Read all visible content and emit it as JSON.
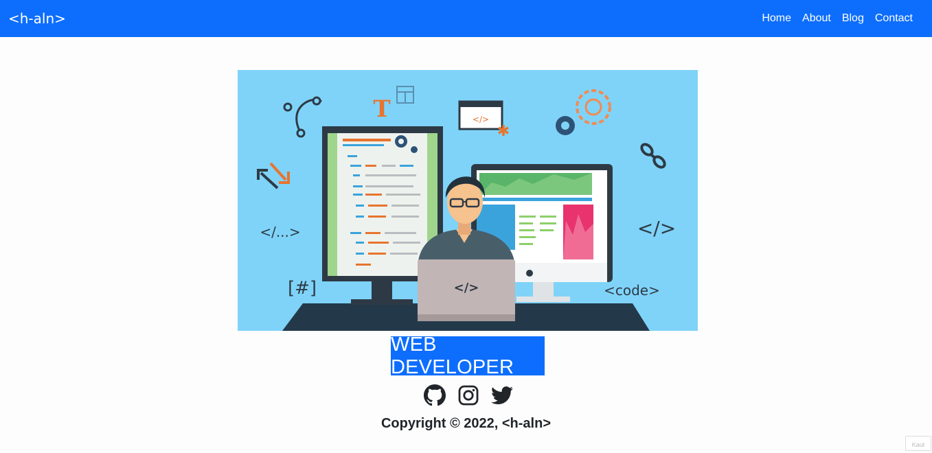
{
  "navbar": {
    "brand": "<h-aln>",
    "links": [
      {
        "label": "Home"
      },
      {
        "label": "About"
      },
      {
        "label": "Blog"
      },
      {
        "label": "Contact"
      }
    ],
    "background": "#0d6efd"
  },
  "hero": {
    "background": "#7fd3f8",
    "text_marks": {
      "tag_slash": "</...>",
      "tag_code_right": "</>",
      "hash": "[#]",
      "code_tag": "<code>",
      "laptop_code": "</>",
      "browser_code": "</>",
      "t_glyph": "T"
    }
  },
  "main": {
    "title": "WEB DEVELOPER",
    "title_background": "#0d6efd"
  },
  "social": [
    {
      "icon": "github-icon"
    },
    {
      "icon": "instagram-icon"
    },
    {
      "icon": "twitter-icon"
    }
  ],
  "footer": {
    "copyright": "Copyright © 2022, <h-aln>"
  },
  "widget": {
    "label": "Kaut"
  }
}
